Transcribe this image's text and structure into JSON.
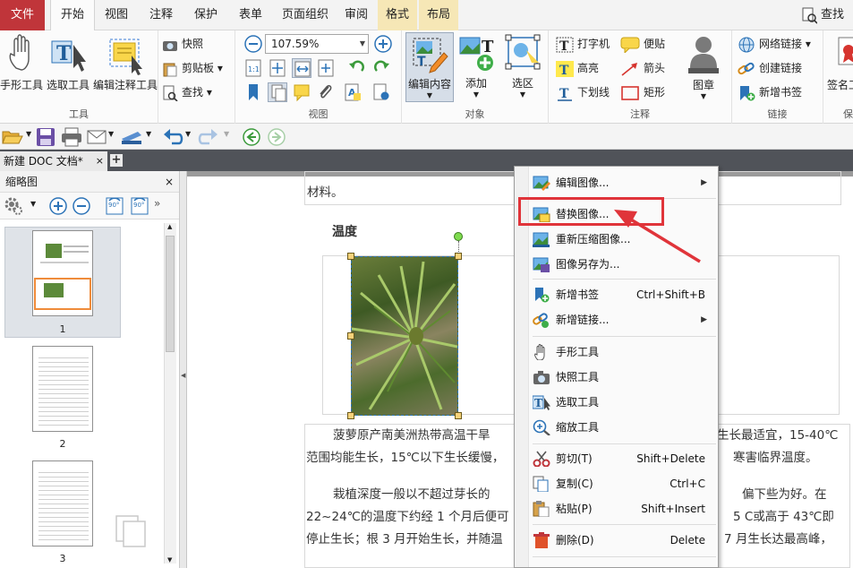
{
  "menubar": {
    "tabs": [
      "文件",
      "开始",
      "视图",
      "注释",
      "保护",
      "表单",
      "页面组织",
      "审阅",
      "格式",
      "布局"
    ],
    "active": "开始",
    "search": "查找(F)"
  },
  "ribbon": {
    "tools_group": {
      "label": "工具",
      "hand": "手形工具",
      "select": "选取工具",
      "annot": "编辑注释工具"
    },
    "snapshot": "快照",
    "clipboard": "剪贴板",
    "find": "查找",
    "view_group": {
      "label": "视图",
      "zoom": "107.59%"
    },
    "object_group": {
      "label": "对象",
      "edit": "编辑内容",
      "add": "添加",
      "select": "选区"
    },
    "annot_group": {
      "label": "注释",
      "typewriter": "打字机",
      "note": "便贴",
      "highlight": "高亮",
      "arrow": "箭头",
      "underline": "下划线",
      "rect": "矩形",
      "stamp": "图章"
    },
    "link_group": {
      "label": "链接",
      "weblink": "网络链接",
      "createlink": "创建链接",
      "bookmark": "新增书签"
    },
    "sign": "签名工",
    "protect": "保"
  },
  "doctab": {
    "name": "新建 DOC 文档*",
    "close": "×",
    "add": "+"
  },
  "thumbs": {
    "title": "缩略图",
    "close": "×",
    "rot_left": "90°",
    "rot_right": "90°",
    "pages": [
      "1",
      "2",
      "3"
    ]
  },
  "doc": {
    "line_top": "材料。",
    "label_temp": "温度",
    "p1a": "菠萝原产南美洲热带高温干旱",
    "p1b": "生长最适宜，15-40℃",
    "p1c": "范围均能生长，15℃以下生长缓慢，",
    "p1d": "寒害临界温度。",
    "p2a": "栽植深度一般以不超过芽长的",
    "p2b": "偏下些为好。在",
    "p2c": "22~24℃的温度下约经 1 个月后便可",
    "p2d": "5 C或高于 43℃即",
    "p3a": "停止生长；根 3 月开始生长，并随温",
    "p3b": "7 月生长达最高峰，"
  },
  "contextmenu": {
    "items": [
      {
        "label": "编辑图像...",
        "shortcut": "",
        "submenu": true
      },
      {
        "label": "替换图像...",
        "shortcut": "",
        "submenu": false
      },
      {
        "label": "重新压缩图像...",
        "shortcut": "",
        "submenu": false
      },
      {
        "label": "图像另存为...",
        "shortcut": "",
        "submenu": false
      },
      {
        "label": "新增书签",
        "shortcut": "Ctrl+Shift+B",
        "submenu": false
      },
      {
        "label": "新增链接...",
        "shortcut": "",
        "submenu": true
      },
      {
        "label": "手形工具",
        "shortcut": "",
        "submenu": false
      },
      {
        "label": "快照工具",
        "shortcut": "",
        "submenu": false
      },
      {
        "label": "选取工具",
        "shortcut": "",
        "submenu": false
      },
      {
        "label": "缩放工具",
        "shortcut": "",
        "submenu": false
      },
      {
        "label": "剪切(T)",
        "shortcut": "Shift+Delete",
        "submenu": false
      },
      {
        "label": "复制(C)",
        "shortcut": "Ctrl+C",
        "submenu": false
      },
      {
        "label": "粘贴(P)",
        "shortcut": "Shift+Insert",
        "submenu": false
      },
      {
        "label": "删除(D)",
        "shortcut": "Delete",
        "submenu": false
      }
    ],
    "highlighted": "替换图像..."
  },
  "colors": {
    "file_tab": "#c0353a",
    "highlight_box": "#e0343a",
    "arrow": "#e0343a"
  }
}
